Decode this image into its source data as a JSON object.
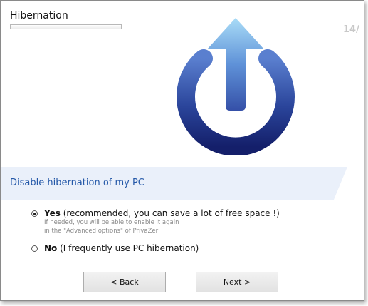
{
  "wizard": {
    "title": "Hibernation",
    "page_number": "14/",
    "progress": 0
  },
  "banner": {
    "text": "Disable hibernation of my PC"
  },
  "options": [
    {
      "label": "Yes",
      "detail": " (recommended, you can save a lot of free space !)",
      "hint_line1": "If needed, you will be able to enable it again",
      "hint_line2": "in the \"Advanced options\" of PrivaZer",
      "selected": true
    },
    {
      "label": "No",
      "detail": " (I frequently use PC hibernation)",
      "selected": false
    }
  ],
  "buttons": {
    "back": "< Back",
    "next": "Next >"
  },
  "icons": {
    "power": "power-icon"
  },
  "colors": {
    "accent": "#2458a8",
    "banner_bg": "#eaf0fa",
    "icon_dark": "#1a2a7a",
    "icon_light": "#9fd4f5"
  }
}
